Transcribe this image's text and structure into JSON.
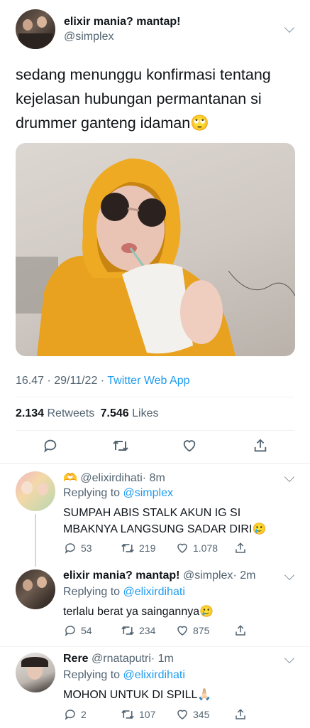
{
  "main_tweet": {
    "display_name": "elixir mania? mantap!",
    "handle": "@simplex",
    "text": "sedang menunggu konfirmasi tentang kejelasan hubungan permantanan si drummer ganteng idaman",
    "emoji": "🙄",
    "time": "16.47 · 29/11/22 · ",
    "source": "Twitter Web App",
    "retweets_count": "2.134",
    "retweets_label": "Retweets",
    "likes_count": "7.546",
    "likes_label": "Likes"
  },
  "replies": [
    {
      "prefix_emoji": "🫶",
      "display_name": "",
      "handle": "@elixirdihati",
      "time": "· 8m",
      "replying_label": "Replying to ",
      "replying_to": "@simplex",
      "text": "SUMPAH ABIS STALK AKUN IG SI MBAKNYA LANGSUNG SADAR DIRI",
      "emoji": "🥲",
      "replies": "53",
      "retweets": "219",
      "likes": "1.078"
    },
    {
      "display_name": "elixir mania? mantap!",
      "handle": "@simplex",
      "time": "· 2m",
      "replying_label": "Replying to ",
      "replying_to": "@elixirdihati",
      "text": "terlalu berat ya saingannya",
      "emoji": "🥲",
      "replies": "54",
      "retweets": "234",
      "likes": "875"
    },
    {
      "display_name": "Rere",
      "handle": "@rnataputri",
      "time": "· 1m",
      "replying_label": "Replying to ",
      "replying_to": "@elixirdihati",
      "text": "MOHON UNTUK DI SPILL",
      "emoji": "🙏🏻",
      "replies": "2",
      "retweets": "107",
      "likes": "345"
    }
  ],
  "colors": {
    "accent": "#1d9bf0",
    "muted": "#536471",
    "hoodie": "#e8a21f"
  }
}
